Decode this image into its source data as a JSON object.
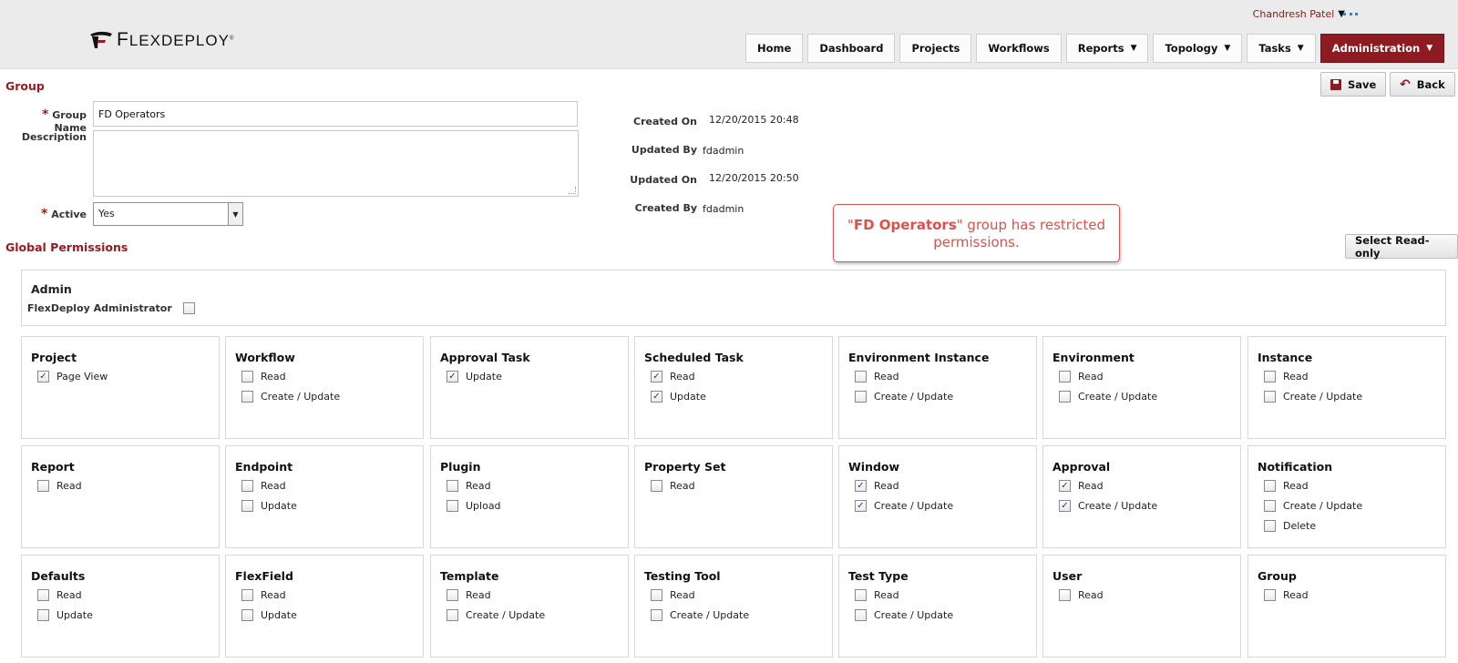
{
  "header": {
    "logo_text_f": "F",
    "logo_text_rest": "LEXDEPLOY",
    "logo_tm": "®",
    "user_name": "Chandresh Patel",
    "nav": [
      {
        "label": "Home",
        "dropdown": false,
        "active": false
      },
      {
        "label": "Dashboard",
        "dropdown": false,
        "active": false
      },
      {
        "label": "Projects",
        "dropdown": false,
        "active": false
      },
      {
        "label": "Workflows",
        "dropdown": false,
        "active": false
      },
      {
        "label": "Reports",
        "dropdown": true,
        "active": false
      },
      {
        "label": "Topology",
        "dropdown": true,
        "active": false
      },
      {
        "label": "Tasks",
        "dropdown": true,
        "active": false
      },
      {
        "label": "Administration",
        "dropdown": true,
        "active": true
      }
    ]
  },
  "group": {
    "section_title": "Group",
    "save_label": "Save",
    "back_label": "Back",
    "name_label": "Group Name",
    "name_value": "FD Operators",
    "description_label": "Description",
    "description_value": "",
    "active_label": "Active",
    "active_value": "Yes",
    "created_on_label": "Created On",
    "created_on_value": "12/20/2015 20:48",
    "updated_by_label": "Updated By",
    "updated_by_value": "fdadmin",
    "updated_on_label": "Updated On",
    "updated_on_value": "12/20/2015 20:50",
    "created_by_label": "Created By",
    "created_by_value": "fdadmin"
  },
  "callout": {
    "quote_open": "\"",
    "strong": "FD Operators",
    "rest": "\" group has restricted permissions."
  },
  "permissions": {
    "section_title": "Global Permissions",
    "select_readonly_label": "Select Read-only",
    "admin_title": "Admin",
    "admin_item_label": "FlexDeploy Administrator",
    "admin_item_checked": false,
    "groups": [
      {
        "title": "Project",
        "items": [
          {
            "label": "Page View",
            "checked": true
          }
        ]
      },
      {
        "title": "Workflow",
        "items": [
          {
            "label": "Read",
            "checked": false
          },
          {
            "label": "Create / Update",
            "checked": false
          }
        ]
      },
      {
        "title": "Approval Task",
        "items": [
          {
            "label": "Update",
            "checked": true
          }
        ]
      },
      {
        "title": "Scheduled Task",
        "items": [
          {
            "label": "Read",
            "checked": true
          },
          {
            "label": "Update",
            "checked": true
          }
        ]
      },
      {
        "title": "Environment Instance",
        "items": [
          {
            "label": "Read",
            "checked": false
          },
          {
            "label": "Create / Update",
            "checked": false
          }
        ]
      },
      {
        "title": "Environment",
        "items": [
          {
            "label": "Read",
            "checked": false
          },
          {
            "label": "Create / Update",
            "checked": false
          }
        ]
      },
      {
        "title": "Instance",
        "items": [
          {
            "label": "Read",
            "checked": false
          },
          {
            "label": "Create / Update",
            "checked": false
          }
        ]
      },
      {
        "title": "Report",
        "items": [
          {
            "label": "Read",
            "checked": false
          }
        ]
      },
      {
        "title": "Endpoint",
        "items": [
          {
            "label": "Read",
            "checked": false
          },
          {
            "label": "Update",
            "checked": false
          }
        ]
      },
      {
        "title": "Plugin",
        "items": [
          {
            "label": "Read",
            "checked": false
          },
          {
            "label": "Upload",
            "checked": false
          }
        ]
      },
      {
        "title": "Property Set",
        "items": [
          {
            "label": "Read",
            "checked": false
          }
        ]
      },
      {
        "title": "Window",
        "items": [
          {
            "label": "Read",
            "checked": true
          },
          {
            "label": "Create / Update",
            "checked": true
          }
        ]
      },
      {
        "title": "Approval",
        "items": [
          {
            "label": "Read",
            "checked": true
          },
          {
            "label": "Create / Update",
            "checked": true
          }
        ]
      },
      {
        "title": "Notification",
        "items": [
          {
            "label": "Read",
            "checked": false
          },
          {
            "label": "Create / Update",
            "checked": false
          },
          {
            "label": "Delete",
            "checked": false
          }
        ]
      },
      {
        "title": "Defaults",
        "items": [
          {
            "label": "Read",
            "checked": false
          },
          {
            "label": "Update",
            "checked": false
          }
        ]
      },
      {
        "title": "FlexField",
        "items": [
          {
            "label": "Read",
            "checked": false
          },
          {
            "label": "Update",
            "checked": false
          }
        ]
      },
      {
        "title": "Template",
        "items": [
          {
            "label": "Read",
            "checked": false
          },
          {
            "label": "Create / Update",
            "checked": false
          }
        ]
      },
      {
        "title": "Testing Tool",
        "items": [
          {
            "label": "Read",
            "checked": false
          },
          {
            "label": "Create / Update",
            "checked": false
          }
        ]
      },
      {
        "title": "Test Type",
        "items": [
          {
            "label": "Read",
            "checked": false
          },
          {
            "label": "Create / Update",
            "checked": false
          }
        ]
      },
      {
        "title": "User",
        "items": [
          {
            "label": "Read",
            "checked": false
          }
        ]
      },
      {
        "title": "Group",
        "items": [
          {
            "label": "Read",
            "checked": false
          }
        ]
      }
    ]
  },
  "colors": {
    "accent": "#8e1a22",
    "section_title": "#9b1b20",
    "callout": "#e0504a",
    "checkmark": "#1c3d7a"
  }
}
